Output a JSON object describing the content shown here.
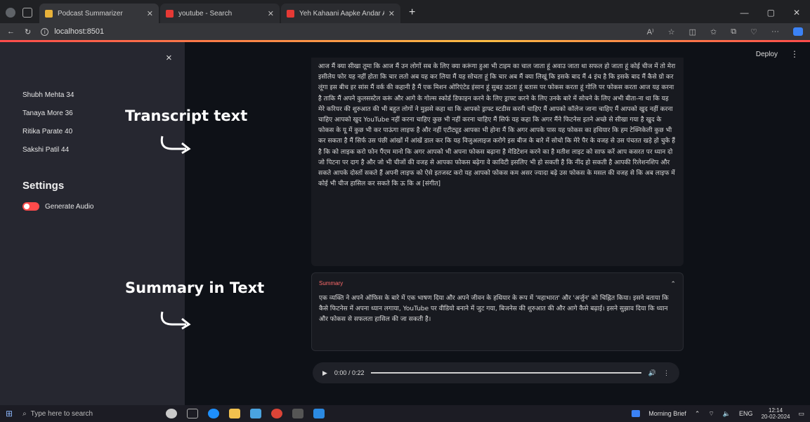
{
  "browser": {
    "tabs": [
      {
        "label": "Podcast Summarizer",
        "favicon_color": "#e8b23a",
        "active": true
      },
      {
        "label": "youtube - Search",
        "favicon_color": "#e53935",
        "active": false
      },
      {
        "label": "Yeh Kahaani Aapke Andar Aag L...",
        "favicon_color": "#e53935",
        "active": false
      }
    ],
    "new_tab_label": "+",
    "url": "localhost:8501"
  },
  "sidebar": {
    "close_label": "×",
    "items": [
      {
        "label": "Shubh Mehta 34"
      },
      {
        "label": "Tanaya More 36"
      },
      {
        "label": "Ritika Parate 40"
      },
      {
        "label": "Sakshi Patil 44"
      }
    ],
    "settings_heading": "Settings",
    "toggle_label": "Generate Audio"
  },
  "header": {
    "deploy_label": "Deploy",
    "menu_label": "⋮"
  },
  "annotations": {
    "transcript": "Transcript text",
    "summary": "Summary in Text"
  },
  "transcript_text": "आज मैं क्या सीखा तूमा कि आज मैं उन लोगों सब के लिए क्या करूंगा हुआ भी टाइम का चाल जाता हूं अवाउ जाता था सफल हो जाता हूं कोई चीज में तो मेरा इसीलेय फोर यह नहीं होता कि चार लतो अब यह कर लिया मैं यह सोचता हूं कि चार अब मैं क्या लिखूं कि इसके बाद मैं 4 इंच है कि इसके बाद मैं कैसे ग्रो कर लूंगा इस बीच इर सांस मैं वर्क की कहानी है मैं एक मिशन ओरिएंटेड इंसान हूं सुबह उठता हूं बतास पर फोकस करता हूं गोलि पर फोकस करता आज यह करना है ताकि मैं अपने कुलसस्टेल करूं और आगे के गोल्स स्कोर्ड डिफाइन करने के लिए ड्राफ्ट करने के लिए उनके बारे में सोचने के लिए अभी बीता-ना था कि यह मेरे करियर की शुरुआत की भी बहुत लोगों ने मुझसे कहा था कि आपको ड्राफ्ट स्टडीस करनी चाहिए मैं आपको कॉलेज जाना चाहिए मैं आपको खुद नहीं करना चाहिए आपको खुद YouTube नहीं करना चाहिए कुछ भी नहीं करना चाहिए मैं सिर्फ यह कहा कि अगर मैंने फिटनेस इतने अच्छे से सीखा गया है खुद के फोकस के यू में कुछ भी कर पाऊंगा लाइफ है और नहीं एटीट्यूड आपका भी होना मैं कि अगर आपके पास यह फोकस का हथियार कि हम टेक्निकेली कुछ भी कर सकता है मैं सिर्फ उस पंछी आंखों में आंखें डाल कर कि यह विजुअलाइज करोगे इस बीज के बारे में सोचो कि मेरे पैर के वजह से उस पंचतत खड़े हो चुके हैं है कि को लाइक करो फोन पैंएम मानो कि अगर आपको भी अपना फोकस बढ़ाना है मेडिटेशन करने का है मतीश लाइट को साफ करें आप कसरत पर ध्यान दो जो पिटना पर दाग है और जो भी चीजों की वजह से आपका फोकस बढ़ेगा वे काविटी इसलिए भी हो सकती है कि नींद हो सकती है आपकी रिलेशनशिप और सकते आपके दोस्तों सकते हैं अपनी लाइफ को ऐसे इतजस्ट करो यह आपको फोकस कम असर ज्यादा बढ़े उस फोकस के मसल की वजह से कि अब लाइफ में कोई भी चीज हासिल कर सकते कि ऊ कि अ [संगीत]",
  "summary": {
    "heading": "Summary",
    "collapse_icon": "⌃",
    "text": "एक व्यक्ति ने अपने ऑफिस के बारे में एक भाषण दिया और अपने जीवन के हथियार के रूप में 'महाभारत' और 'अर्जुन' को चिह्नित किया। इसने बताया कि कैसे फिटनेस में अपना ध्यान लगाया, YouTube पर वीडियो बनाने में जुट गया, बिजनेस की शुरुआत की और आगे कैसे बढ़ाई। इसने सुझाव दिया कि ध्यान और फोकस से सफलता हासिल की जा सकती है।"
  },
  "audio": {
    "play_icon": "▶",
    "time": "0:00 / 0:22",
    "progress": 0,
    "volume_icon": "🔊",
    "more_icon": "⋮"
  },
  "taskbar": {
    "search_placeholder": "Type here to search",
    "weather_label": "Morning Brief",
    "lang": "ENG",
    "time": "12:14",
    "date": "20-02-2024"
  },
  "colors": {
    "accent": "#ff4b4b",
    "sidebar_bg": "#262730",
    "main_bg": "#0e1117"
  }
}
